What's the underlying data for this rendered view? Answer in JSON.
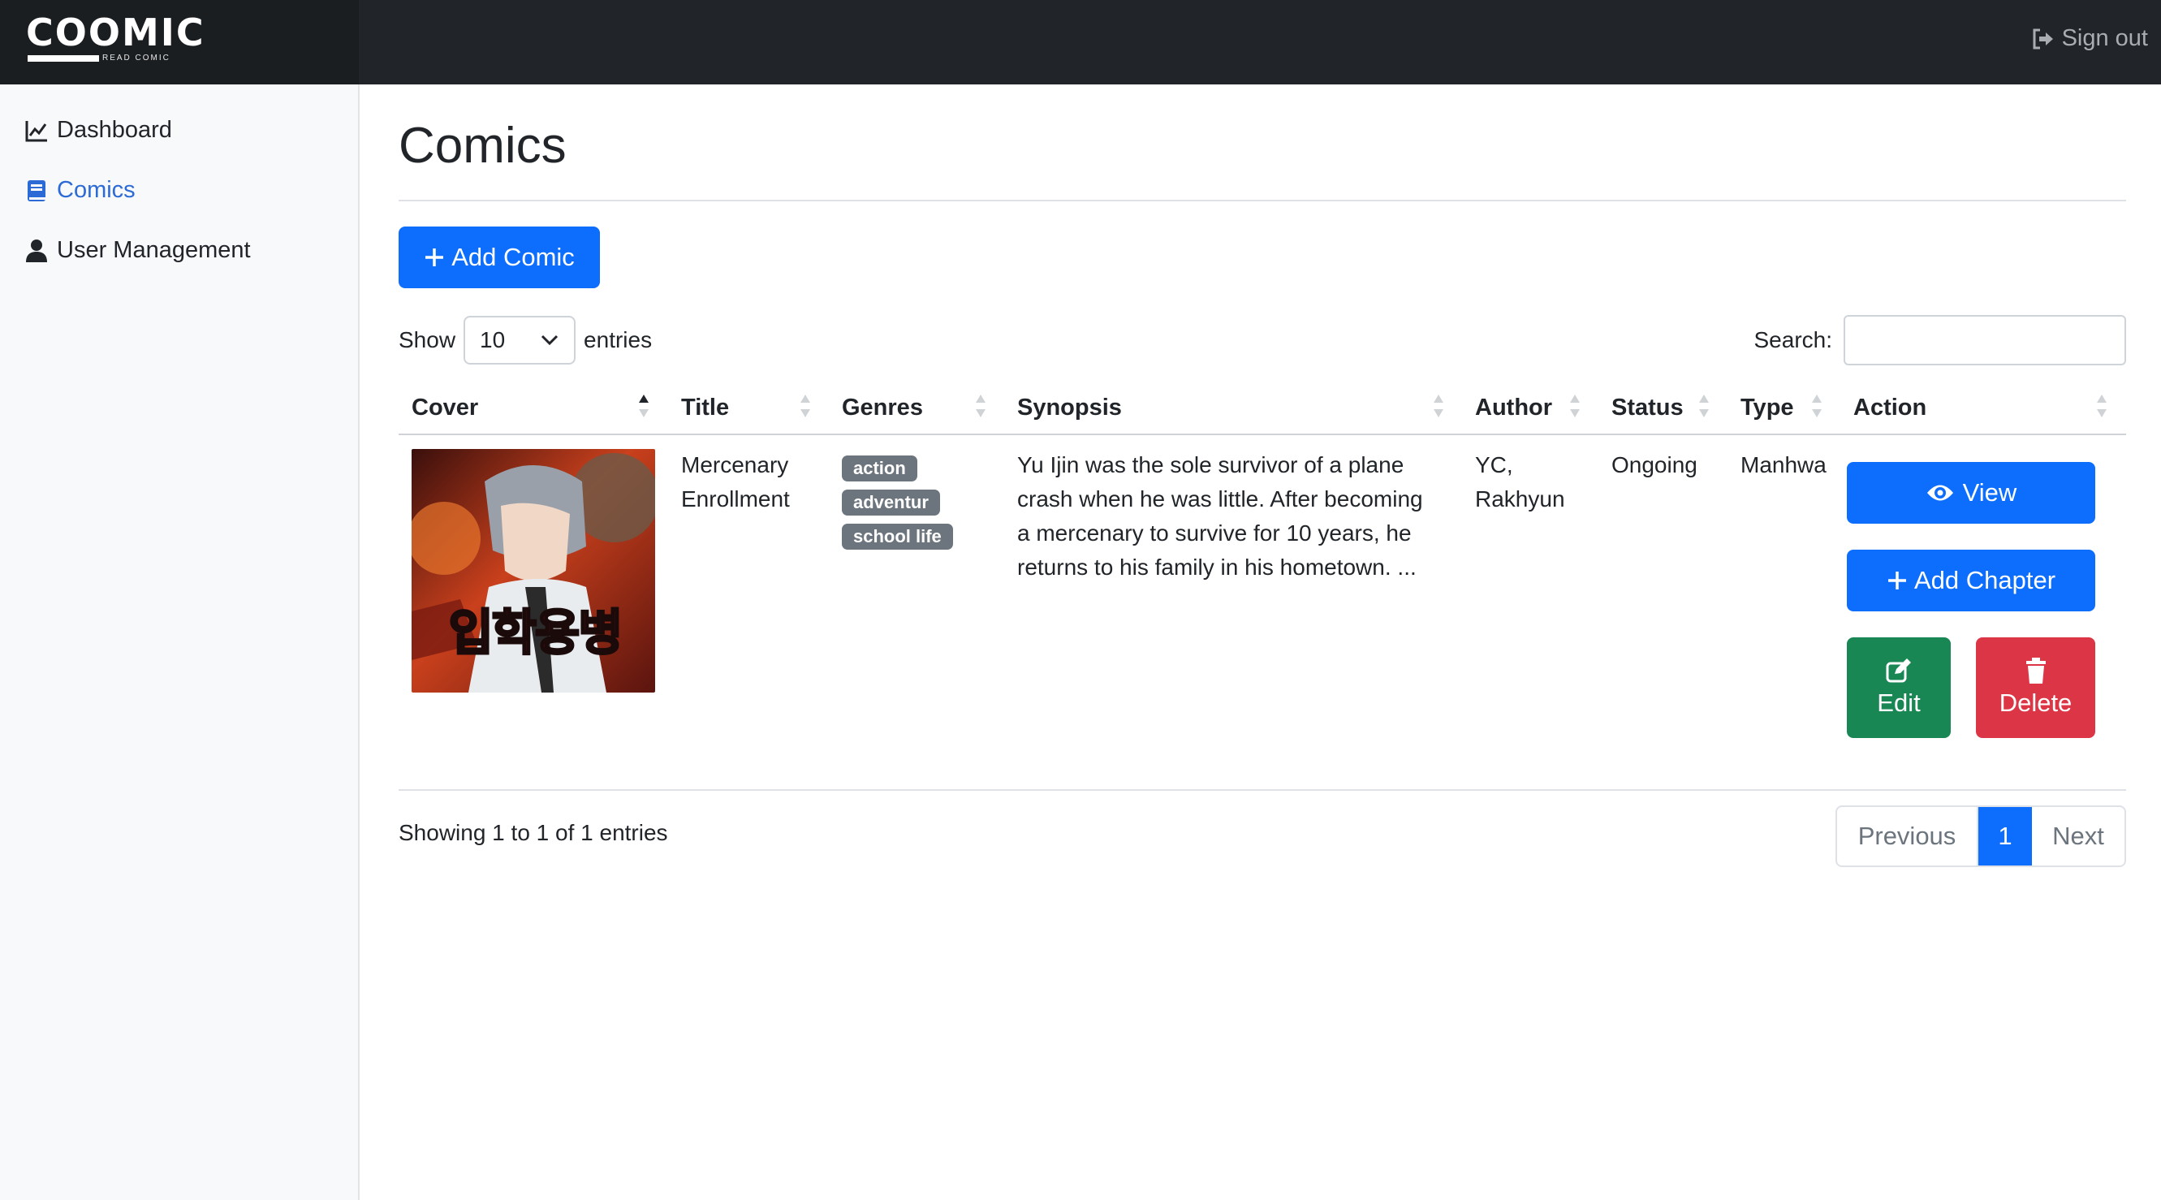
{
  "brand": {
    "name": "COOMIC",
    "tagline": "READ COMIC"
  },
  "navbar": {
    "signout_label": "Sign out"
  },
  "sidebar": {
    "items": [
      {
        "label": "Dashboard",
        "icon": "chart-line-icon",
        "active": false
      },
      {
        "label": "Comics",
        "icon": "book-icon",
        "active": true
      },
      {
        "label": "User Management",
        "icon": "user-icon",
        "active": false
      }
    ]
  },
  "page": {
    "title": "Comics",
    "add_button": "Add Comic"
  },
  "table_controls": {
    "show_label": "Show",
    "page_length": "10",
    "entries_label": "entries",
    "search_label": "Search:",
    "search_value": ""
  },
  "table": {
    "columns": [
      "Cover",
      "Title",
      "Genres",
      "Synopsis",
      "Author",
      "Status",
      "Type",
      "Action"
    ],
    "rows": [
      {
        "cover_text": "입학용병",
        "title_line1": "Mercenary",
        "title_line2": "Enrollment",
        "genres": [
          "action",
          "adventur",
          "school life"
        ],
        "synopsis_lines": [
          "Yu Ijin was the sole survivor of a plane",
          "crash when he was little. After becoming",
          "a mercenary to survive for 10 years, he",
          "returns to his family in his hometown. ..."
        ],
        "author_line1": "YC,",
        "author_line2": "Rakhyun",
        "status": "Ongoing",
        "type": "Manhwa",
        "actions": {
          "view": "View",
          "add_chapter": "Add Chapter",
          "edit": "Edit",
          "delete": "Delete"
        }
      }
    ]
  },
  "footer": {
    "info": "Showing 1 to 1 of 1 entries",
    "pagination": {
      "previous": "Previous",
      "current": "1",
      "next": "Next"
    }
  },
  "colors": {
    "primary": "#0d6efd",
    "success": "#198754",
    "danger": "#dc3545",
    "badge": "#6c757d",
    "navbar": "#212529",
    "sidebar_active": "#2c6bd6"
  }
}
